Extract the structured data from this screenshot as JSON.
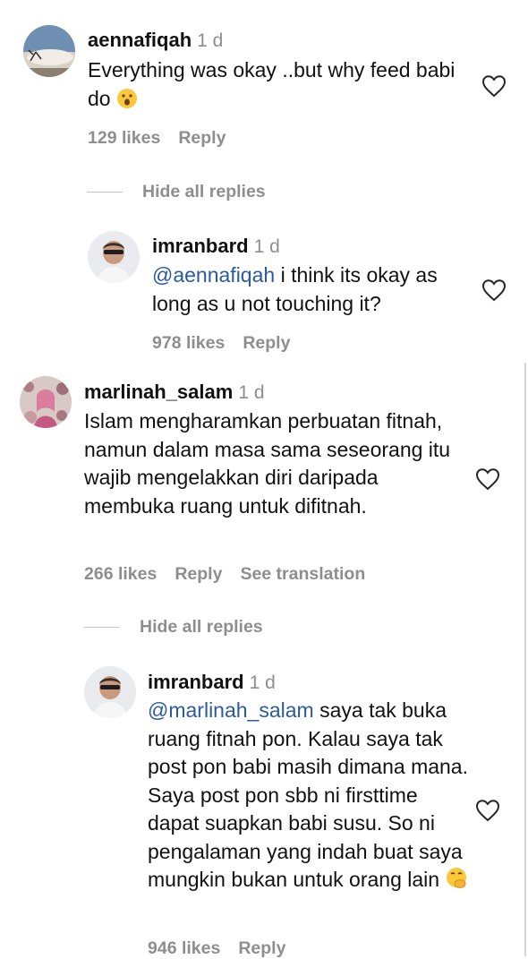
{
  "comments": [
    {
      "username": "aennafiqah",
      "time": "1 d",
      "text": "Everything was okay ..but why feed babi do",
      "likes": "129 likes",
      "reply": "Reply",
      "hide_replies": "Hide all replies",
      "replies": [
        {
          "username": "imranbard",
          "time": "1 d",
          "mention": "@aennafiqah",
          "text": " i think its okay as long as u not touching it?",
          "likes": "978 likes",
          "reply": "Reply"
        }
      ]
    },
    {
      "username": "marlinah_salam",
      "time": "1 d",
      "text": "Islam mengharamkan perbuatan fitnah, namun dalam masa sama seseorang itu wajib mengelakkan diri daripada membuka ruang untuk difitnah.",
      "likes": "266 likes",
      "reply": "Reply",
      "see_translation": "See translation",
      "hide_replies": "Hide all replies",
      "replies": [
        {
          "username": "imranbard",
          "time": "1 d",
          "mention": "@marlinah_salam",
          "text": " saya tak buka ruang fitnah pon. Kalau saya tak post pon babi masih dimana mana. Saya post pon sbb ni firsttime dapat suapkan babi susu. So ni pengalaman yang indah buat saya mungkin bukan untuk orang lain",
          "likes": "946 likes",
          "reply": "Reply"
        }
      ]
    }
  ],
  "icons": {
    "like": "heart-outline-icon",
    "surprised": "face-open-mouth-emoji",
    "shush": "face-hand-over-mouth-emoji"
  },
  "colors": {
    "text": "#111111",
    "muted": "#8e8e8e",
    "mention": "#2a5a9f"
  }
}
